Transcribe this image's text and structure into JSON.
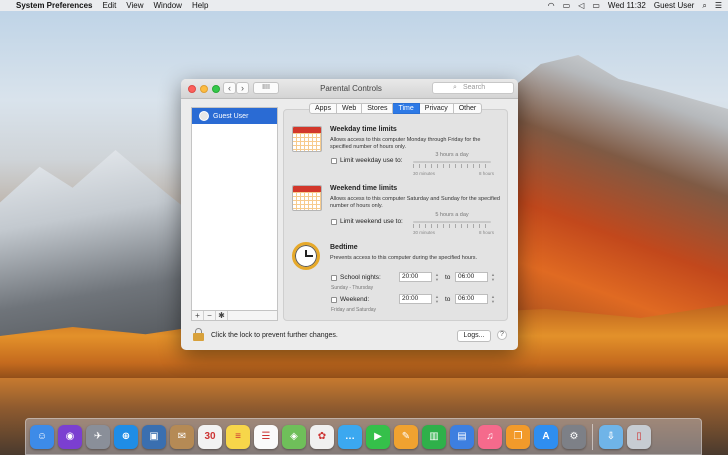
{
  "menubar": {
    "app_name": "System Preferences",
    "menus": [
      "Edit",
      "View",
      "Window",
      "Help"
    ],
    "clock": "Wed 11:32",
    "user": "Guest User"
  },
  "window": {
    "title": "Parental Controls",
    "search_placeholder": "Search",
    "grid_button": "IIII"
  },
  "sidebar": {
    "users": [
      {
        "label": "Guest User"
      }
    ],
    "add": "+",
    "remove": "−",
    "gear": "✱"
  },
  "tabs": [
    {
      "label": "Apps",
      "active": false
    },
    {
      "label": "Web",
      "active": false
    },
    {
      "label": "Stores",
      "active": false
    },
    {
      "label": "Time",
      "active": true
    },
    {
      "label": "Privacy",
      "active": false
    },
    {
      "label": "Other",
      "active": false
    }
  ],
  "weekday": {
    "title": "Weekday time limits",
    "description": "Allows access to this computer Monday through Friday for the specified number of hours only.",
    "checkbox_label": "Limit weekday use to:",
    "slider_value": "3 hours a day",
    "slider_min": "30 minutes",
    "slider_max": "8 hours",
    "slider_fraction": 0.35
  },
  "weekend": {
    "title": "Weekend time limits",
    "description": "Allows access to this computer Saturday and Sunday for the specified number of hours only.",
    "checkbox_label": "Limit weekend use to:",
    "slider_value": "5 hours a day",
    "slider_min": "30 minutes",
    "slider_max": "8 hours",
    "slider_fraction": 0.6
  },
  "bedtime": {
    "title": "Bedtime",
    "description": "Prevents access to this computer during the specified hours.",
    "school_nights_label": "School nights:",
    "school_nights_sub": "Sunday - Thursday",
    "school_from": "20:00",
    "school_to": "06:00",
    "weekend_label": "Weekend:",
    "weekend_sub": "Friday and Saturday",
    "weekend_from": "20:00",
    "weekend_to": "06:00",
    "to_label": "to"
  },
  "footer": {
    "lock_text": "Click the lock to prevent further changes.",
    "logs_button": "Logs...",
    "help_button": "?"
  },
  "dock": {
    "items": [
      {
        "name": "finder-icon",
        "color": "#3d8be8",
        "glyph": "☺"
      },
      {
        "name": "siri-icon",
        "color": "#7b3fd1",
        "glyph": "◉"
      },
      {
        "name": "launchpad-icon",
        "color": "#8a8f99",
        "glyph": "✈"
      },
      {
        "name": "safari-icon",
        "color": "#1f8de6",
        "glyph": "⊕"
      },
      {
        "name": "photo-booth-icon",
        "color": "#3a6fb0",
        "glyph": "▣"
      },
      {
        "name": "contacts-icon",
        "color": "#b58a55",
        "glyph": "✉"
      },
      {
        "name": "calendar-icon",
        "color": "#f2f2f2",
        "glyph": "30"
      },
      {
        "name": "notes-icon",
        "color": "#f7d64a",
        "glyph": "≡"
      },
      {
        "name": "reminders-icon",
        "color": "#fafafa",
        "glyph": "☰"
      },
      {
        "name": "maps-icon",
        "color": "#6fbf5a",
        "glyph": "◈"
      },
      {
        "name": "photos-icon",
        "color": "#f0f0f0",
        "glyph": "✿"
      },
      {
        "name": "messages-icon",
        "color": "#3ba8f0",
        "glyph": "…"
      },
      {
        "name": "facetime-icon",
        "color": "#35c04a",
        "glyph": "▶"
      },
      {
        "name": "pages-icon",
        "color": "#f0a230",
        "glyph": "✎"
      },
      {
        "name": "numbers-icon",
        "color": "#2fb04a",
        "glyph": "▥"
      },
      {
        "name": "keynote-icon",
        "color": "#3d7fe0",
        "glyph": "▤"
      },
      {
        "name": "itunes-icon",
        "color": "#f56a8c",
        "glyph": "♫"
      },
      {
        "name": "ibooks-icon",
        "color": "#f29a2a",
        "glyph": "❐"
      },
      {
        "name": "app-store-icon",
        "color": "#2f8ef0",
        "glyph": "A"
      },
      {
        "name": "system-preferences-icon",
        "color": "#7d8087",
        "glyph": "⚙"
      },
      {
        "name": "downloads-folder-icon",
        "color": "#6fb4e8",
        "glyph": "⇩"
      },
      {
        "name": "trash-icon",
        "color": "#c7ccd2",
        "glyph": "▯"
      }
    ]
  },
  "colors": {
    "accent": "#2d79e6",
    "selection": "#2a6bd4"
  }
}
